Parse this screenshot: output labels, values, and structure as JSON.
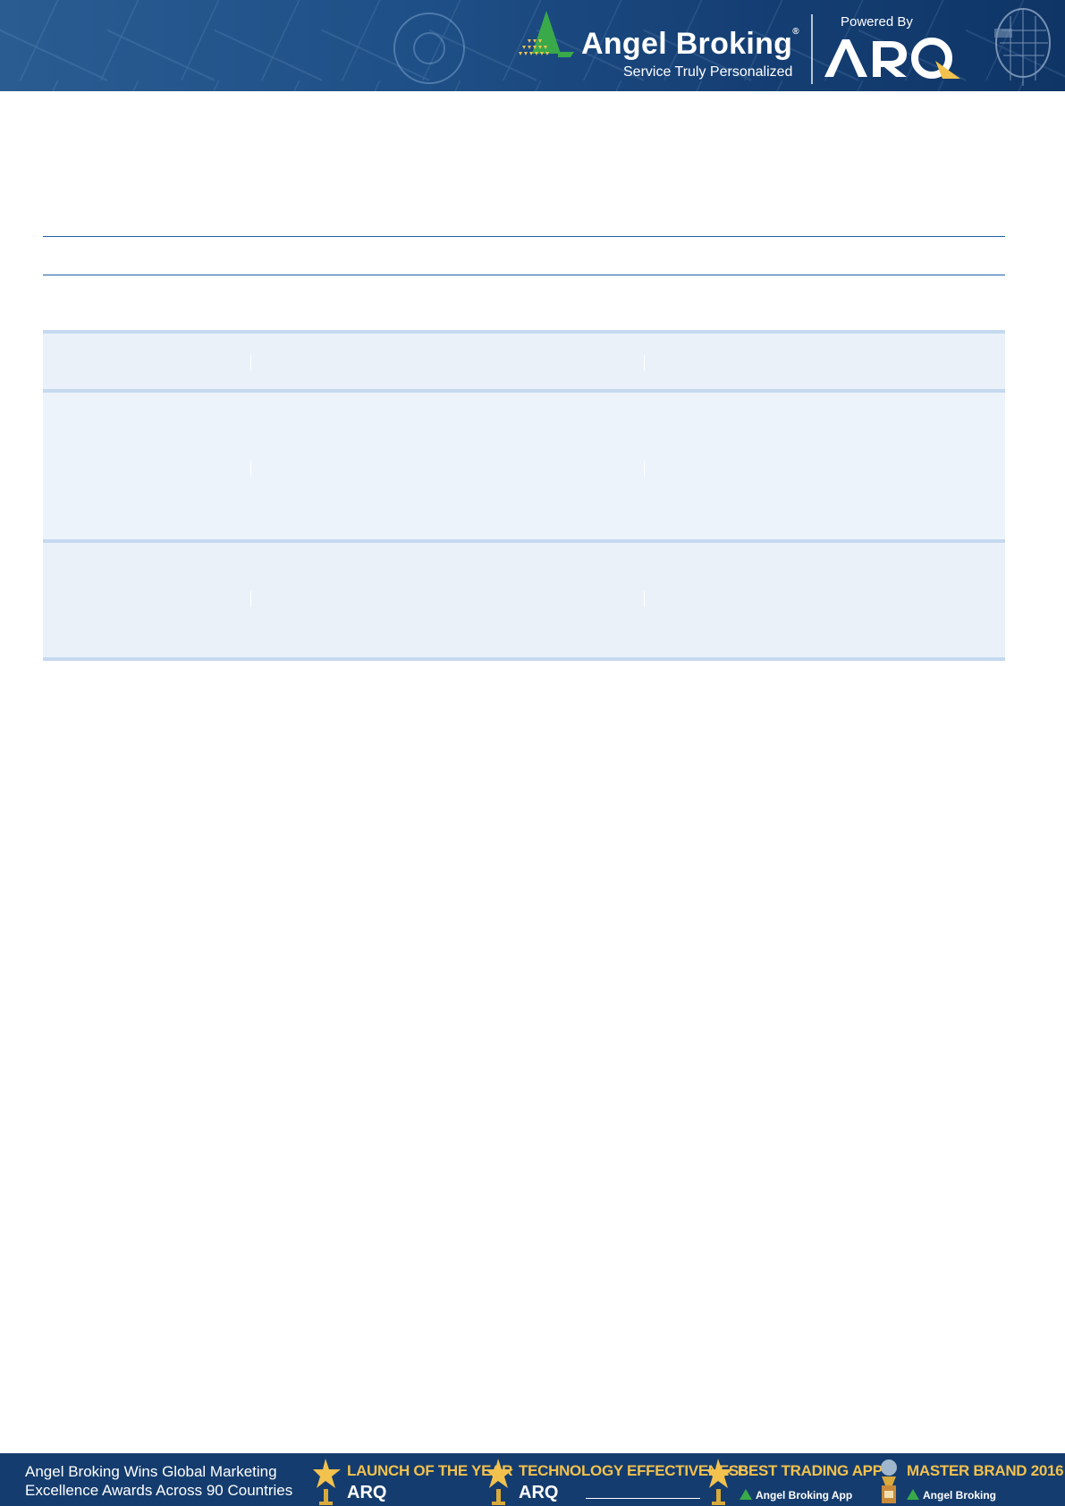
{
  "header": {
    "brand_name": "Angel Broking",
    "brand_registered": "®",
    "tagline": "Service Truly Personalized",
    "powered_by": "Powered By",
    "arq_logo_text": "ARQ",
    "colors": {
      "banner": "#1e4f86",
      "logo_green": "#39a94a",
      "logo_gold": "#f2c14e"
    }
  },
  "document": {
    "rule_color": "#1f5fa8",
    "table_row_color": "#eaf1f9",
    "table_border_color": "#c5d9ef"
  },
  "footer": {
    "headline_line1": "Angel Broking Wins Global Marketing",
    "headline_line2": "Excellence Awards Across 90 Countries",
    "awards": [
      {
        "title": "LAUNCH OF THE YEAR",
        "sub": "ARQ"
      },
      {
        "title": "TECHNOLOGY EFFECTIVENESS",
        "sub": "ARQ"
      },
      {
        "title": "BEST TRADING APP",
        "sub": "Angel Broking App"
      },
      {
        "title": "MASTER BRAND 2016",
        "sub": "Angel Broking"
      }
    ]
  }
}
